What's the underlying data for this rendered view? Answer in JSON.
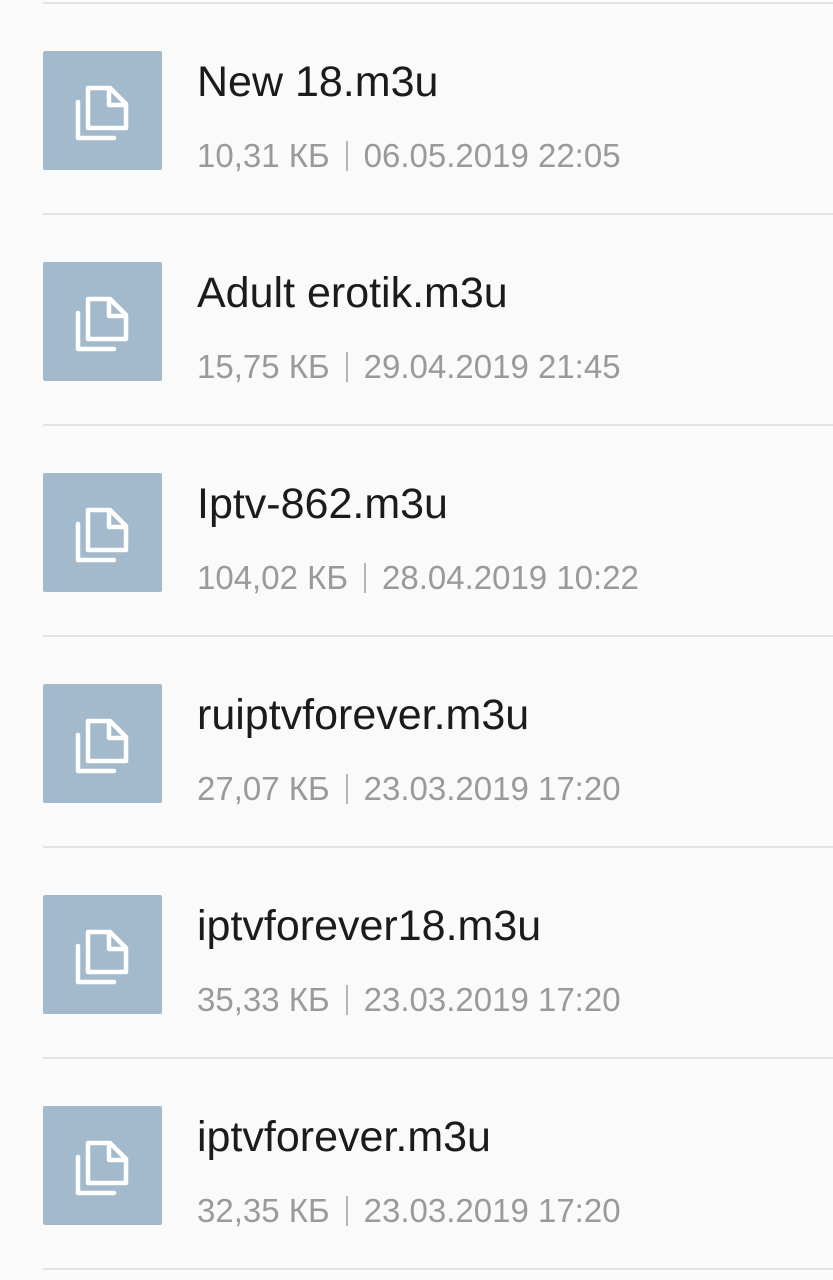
{
  "files": [
    {
      "name": "New 18.m3u",
      "size": "10,31 КБ",
      "date": "06.05.2019 22:05",
      "icon": "file-copy-icon"
    },
    {
      "name": "Adult erotik.m3u",
      "size": "15,75 КБ",
      "date": "29.04.2019 21:45",
      "icon": "file-copy-icon"
    },
    {
      "name": "Iptv-862.m3u",
      "size": "104,02 КБ",
      "date": "28.04.2019 10:22",
      "icon": "file-copy-icon"
    },
    {
      "name": "ruiptvforever.m3u",
      "size": "27,07 КБ",
      "date": "23.03.2019 17:20",
      "icon": "file-copy-icon"
    },
    {
      "name": "iptvforever18.m3u",
      "size": "35,33 КБ",
      "date": "23.03.2019 17:20",
      "icon": "file-copy-icon"
    },
    {
      "name": "iptvforever.m3u",
      "size": "32,35 КБ",
      "date": "23.03.2019 17:20",
      "icon": "file-copy-icon"
    }
  ],
  "colors": {
    "thumb_bg": "#a3b9cc",
    "title_text": "#1b1b1b",
    "meta_text": "#9a9a9a",
    "divider": "#e3e3e3",
    "background": "#fafafa"
  }
}
